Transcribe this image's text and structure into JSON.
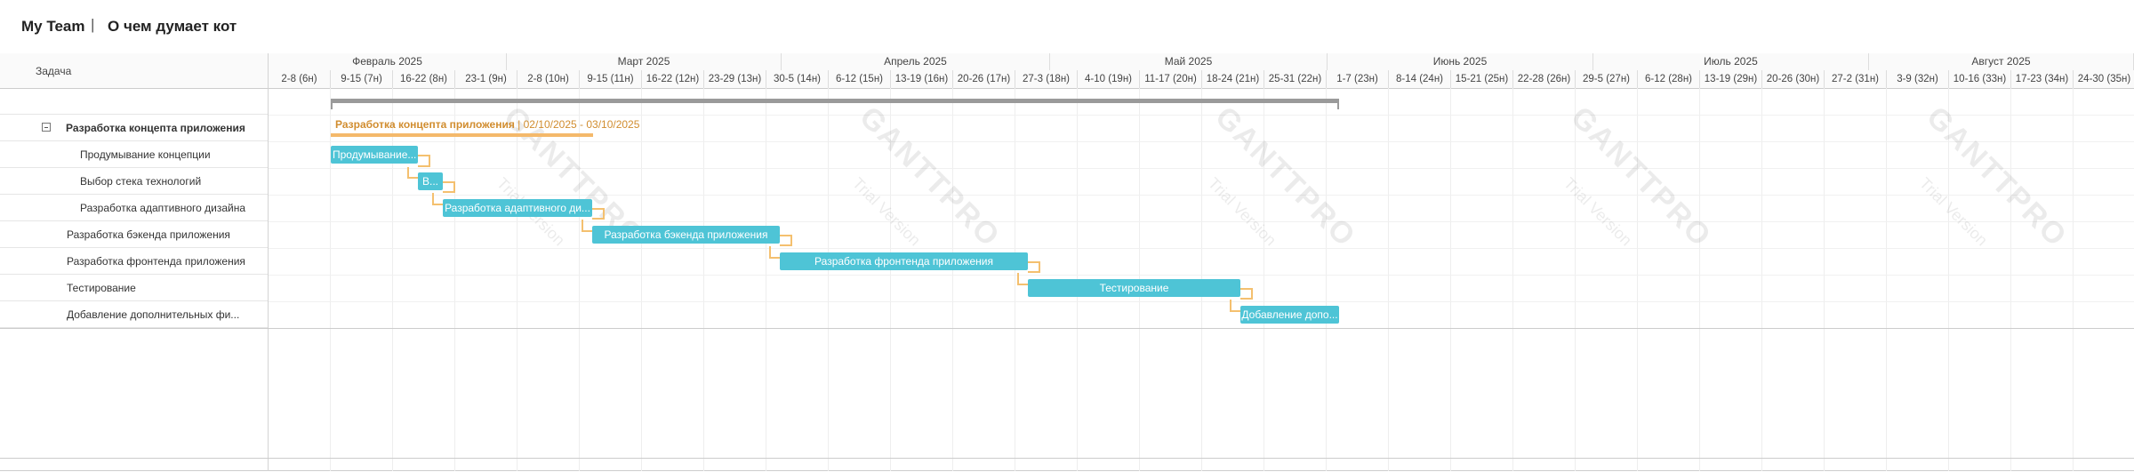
{
  "header": {
    "team": "My Team",
    "separator": "|",
    "project": "О чем думает кот"
  },
  "left": {
    "column_header": "Задача"
  },
  "tasks": [
    {
      "label": "",
      "level": 0
    },
    {
      "label": "Разработка концепта приложения",
      "level": 1
    },
    {
      "label": "Продумывание концепции",
      "level": 2
    },
    {
      "label": "Выбор стека технологий",
      "level": 2
    },
    {
      "label": "Разработка адаптивного дизайна",
      "level": 2
    },
    {
      "label": "Разработка бэкенда приложения",
      "level": 1
    },
    {
      "label": "Разработка фронтенда приложения",
      "level": 1
    },
    {
      "label": "Тестирование",
      "level": 1
    },
    {
      "label": "Добавление дополнительных фи...",
      "level": 1
    }
  ],
  "months": [
    "Февраль 2025",
    "Март 2025",
    "Апрель 2025",
    "Май 2025",
    "Июнь 2025",
    "Июль 2025",
    "Август 2025"
  ],
  "weeks": [
    "2-8 (6н)",
    "9-15 (7н)",
    "16-22 (8н)",
    "23-1 (9н)",
    "2-8 (10н)",
    "9-15 (11н)",
    "16-22 (12н)",
    "23-29 (13н)",
    "30-5 (14н)",
    "6-12 (15н)",
    "13-19 (16н)",
    "20-26 (17н)",
    "27-3 (18н)",
    "4-10 (19н)",
    "11-17 (20н)",
    "18-24 (21н)",
    "25-31 (22н)",
    "1-7 (23н)",
    "8-14 (24н)",
    "15-21 (25н)",
    "22-28 (26н)",
    "29-5 (27н)",
    "6-12 (28н)",
    "13-19 (29н)",
    "20-26 (30н)",
    "27-2 (31н)",
    "3-9 (32н)",
    "10-16 (33н)",
    "17-23 (34н)",
    "24-30 (35н)"
  ],
  "summary": {
    "name": "Разработка концепта приложения",
    "dates": "02/10/2025 - 03/10/2025"
  },
  "bars": {
    "b1": "Продумывание...",
    "b2": "В...",
    "b3": "Разработка адаптивного ди...",
    "b4": "Разработка бэкенда приложения",
    "b5": "Разработка фронтенда приложения",
    "b6": "Тестирование",
    "b7": "Добавление допо..."
  },
  "watermark": {
    "brand": "GANTTPRO",
    "sub": "Trial Version"
  },
  "colors": {
    "task_bar": "#4ec4d6",
    "summary_bar": "#f4b96b",
    "dependency": "#f4c06f",
    "project_bar": "#9a9a9a"
  }
}
